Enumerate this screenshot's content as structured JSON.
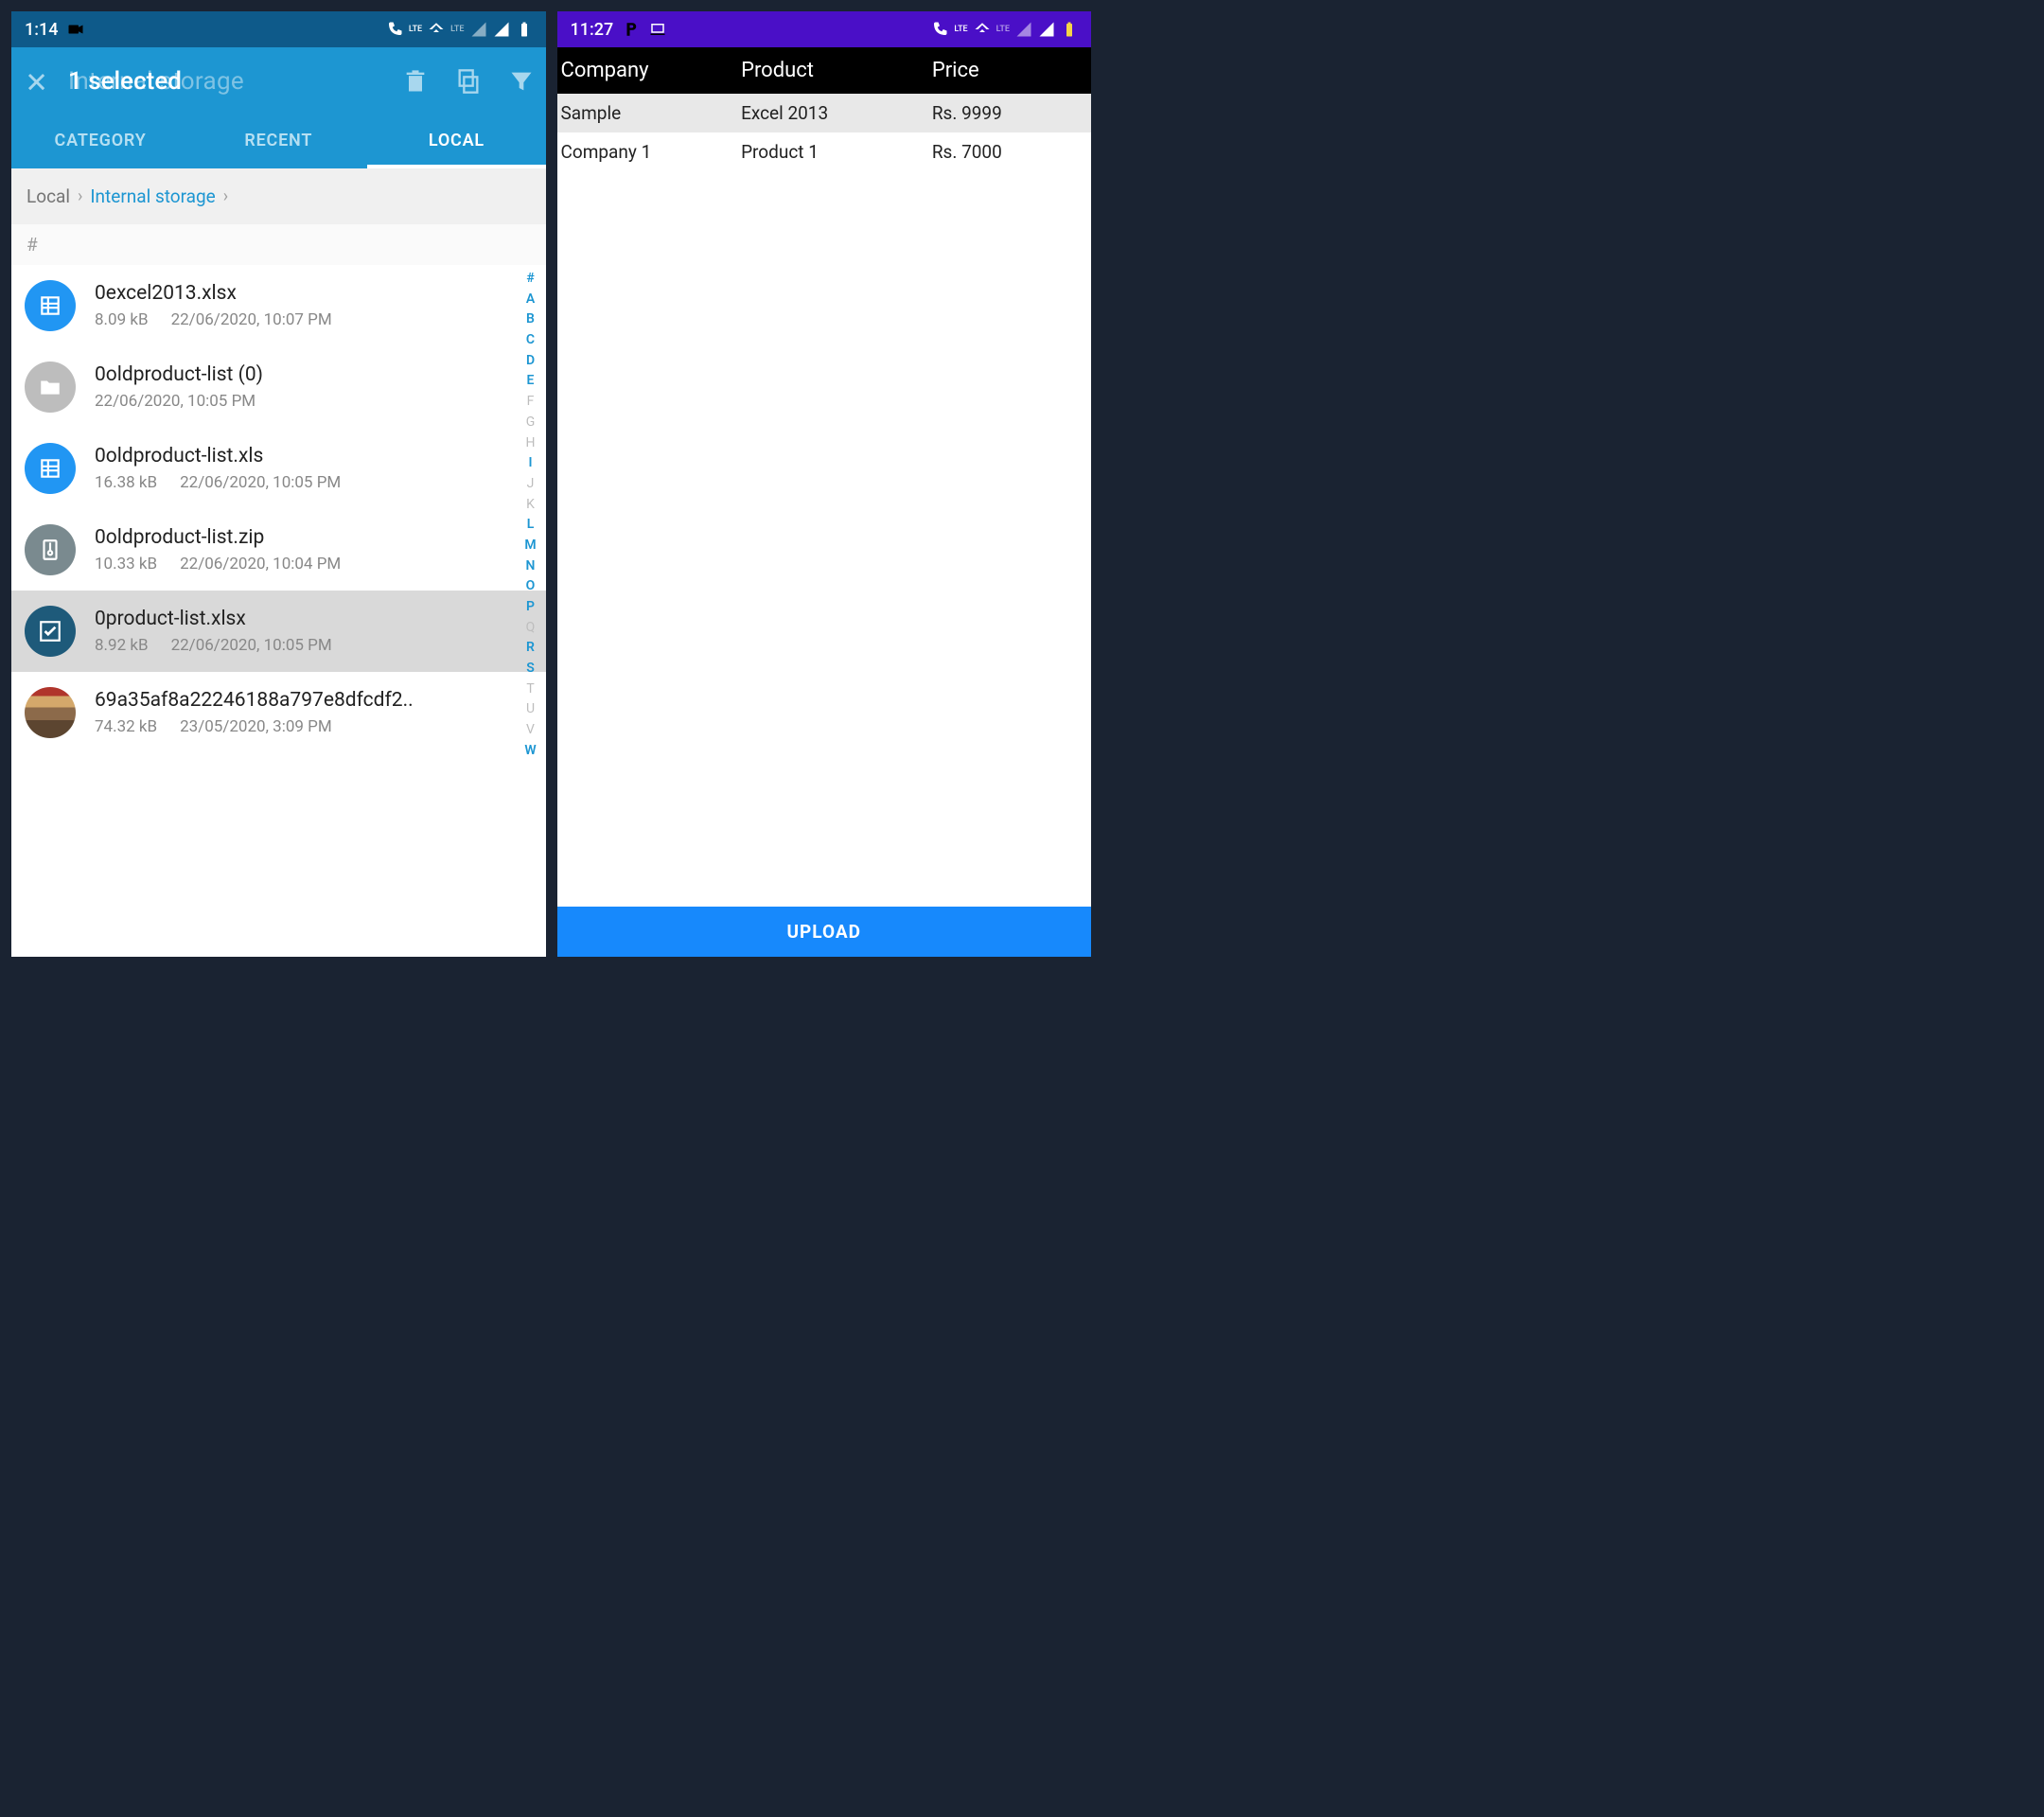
{
  "left": {
    "status_time": "1:14",
    "appbar_bg_title": "Internal storage",
    "appbar_fg_title": "   1 selected",
    "tabs": [
      "CATEGORY",
      "RECENT",
      "LOCAL"
    ],
    "active_tab": 2,
    "breadcrumb": {
      "root": "Local",
      "current": "Internal storage"
    },
    "section_hash": "#",
    "files": [
      {
        "icon": "sheet",
        "name": "0excel2013.xlsx",
        "size": "8.09 kB",
        "date": "22/06/2020, 10:07 PM",
        "selected": false
      },
      {
        "icon": "folder",
        "name": "0oldproduct-list (0)",
        "size": "",
        "date": "22/06/2020, 10:05 PM",
        "selected": false
      },
      {
        "icon": "sheet",
        "name": "0oldproduct-list.xls",
        "size": "16.38 kB",
        "date": "22/06/2020, 10:05 PM",
        "selected": false
      },
      {
        "icon": "zip",
        "name": "0oldproduct-list.zip",
        "size": "10.33 kB",
        "date": "22/06/2020, 10:04 PM",
        "selected": false
      },
      {
        "icon": "check",
        "name": "0product-list.xlsx",
        "size": "8.92 kB",
        "date": "22/06/2020, 10:05 PM",
        "selected": true
      },
      {
        "icon": "img",
        "name": "69a35af8a22246188a797e8dfcdf2..",
        "size": "74.32 kB",
        "date": "23/05/2020, 3:09 PM",
        "selected": false
      }
    ],
    "index_letters": [
      "#",
      "A",
      "B",
      "C",
      "D",
      "E",
      "F",
      "G",
      "H",
      "I",
      "J",
      "K",
      "L",
      "M",
      "N",
      "O",
      "P",
      "Q",
      "R",
      "S",
      "T",
      "U",
      "V",
      "W"
    ],
    "index_active": [
      "#",
      "A",
      "B",
      "C",
      "D",
      "E",
      "I",
      "L",
      "M",
      "N",
      "O",
      "P",
      "R",
      "S",
      "W"
    ]
  },
  "right": {
    "status_time": "11:27",
    "headers": {
      "company": "Company",
      "product": "Product",
      "price": "Price"
    },
    "rows": [
      {
        "company": "Sample",
        "product": "Excel 2013",
        "price": "Rs. 9999"
      },
      {
        "company": "Company 1",
        "product": "Product 1",
        "price": "Rs. 7000"
      }
    ],
    "upload_label": "UPLOAD"
  }
}
